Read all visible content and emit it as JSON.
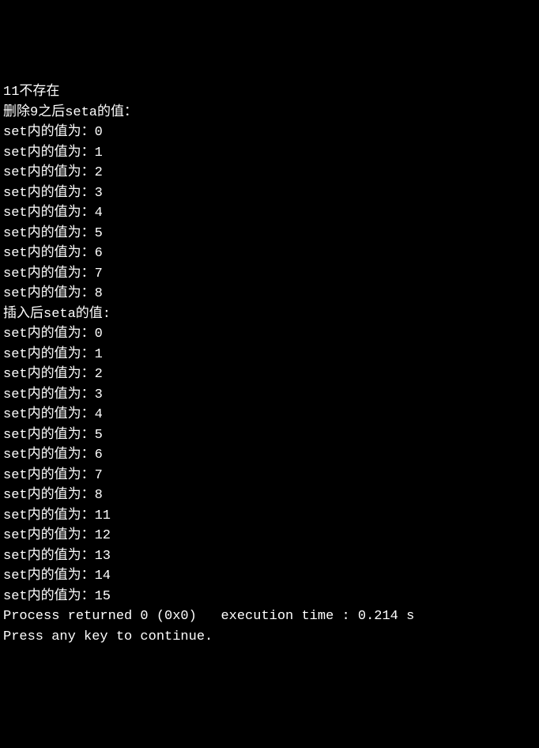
{
  "lines": [
    "11不存在",
    "删除9之后seta的值：",
    "set内的值为：0",
    "set内的值为：1",
    "set内的值为：2",
    "set内的值为：3",
    "set内的值为：4",
    "set内的值为：5",
    "set内的值为：6",
    "set内的值为：7",
    "set内的值为：8",
    "插入后seta的值:",
    "set内的值为：0",
    "set内的值为：1",
    "set内的值为：2",
    "set内的值为：3",
    "set内的值为：4",
    "set内的值为：5",
    "set内的值为：6",
    "set内的值为：7",
    "set内的值为：8",
    "set内的值为：11",
    "set内的值为：12",
    "set内的值为：13",
    "set内的值为：14",
    "set内的值为：15",
    "",
    "Process returned 0 (0x0)   execution time : 0.214 s",
    "Press any key to continue."
  ]
}
